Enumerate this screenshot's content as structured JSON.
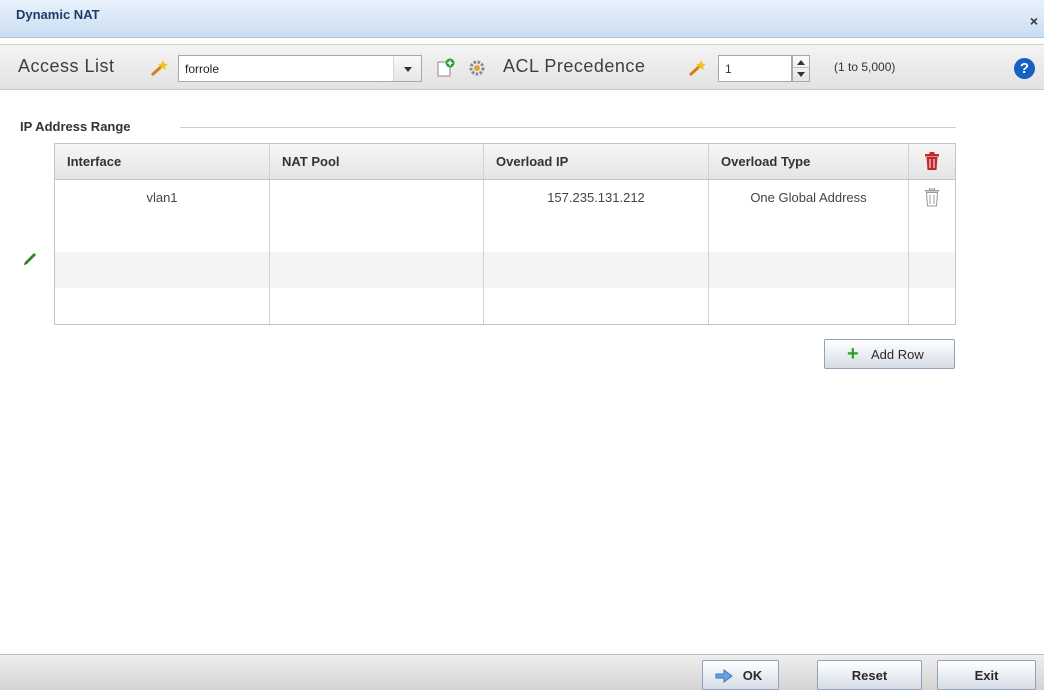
{
  "dialog": {
    "title": "Dynamic NAT",
    "close_glyph": "×"
  },
  "toolbar": {
    "access_list_label": "Access List",
    "access_list_value": "forrole",
    "acl_precedence_label": "ACL Precedence",
    "acl_precedence_value": "1",
    "acl_precedence_range": "(1 to 5,000)",
    "help_glyph": "?"
  },
  "section": {
    "title": "IP Address Range"
  },
  "table": {
    "columns": [
      "Interface",
      "NAT Pool",
      "Overload IP",
      "Overload Type"
    ],
    "rows": [
      {
        "interface": "vlan1",
        "nat_pool": "",
        "overload_ip": "157.235.131.212",
        "overload_type": "One Global Address"
      }
    ]
  },
  "buttons": {
    "add_row": "Add Row",
    "ok": "OK",
    "reset": "Reset",
    "exit": "Exit"
  },
  "colors": {
    "titlebar": "#c9ddf1",
    "title_text": "#1f3c66",
    "help": "#1460c3",
    "add_icon": "#2aa02a",
    "trash_header": "#c0282a"
  },
  "icons": {
    "wand": "magic-wand-icon",
    "new": "new-item-icon",
    "settings": "gear-icon",
    "trash": "trash-icon",
    "edit": "pencil-icon",
    "add": "plus-icon",
    "ok": "arrow-icon",
    "help": "question-icon"
  }
}
